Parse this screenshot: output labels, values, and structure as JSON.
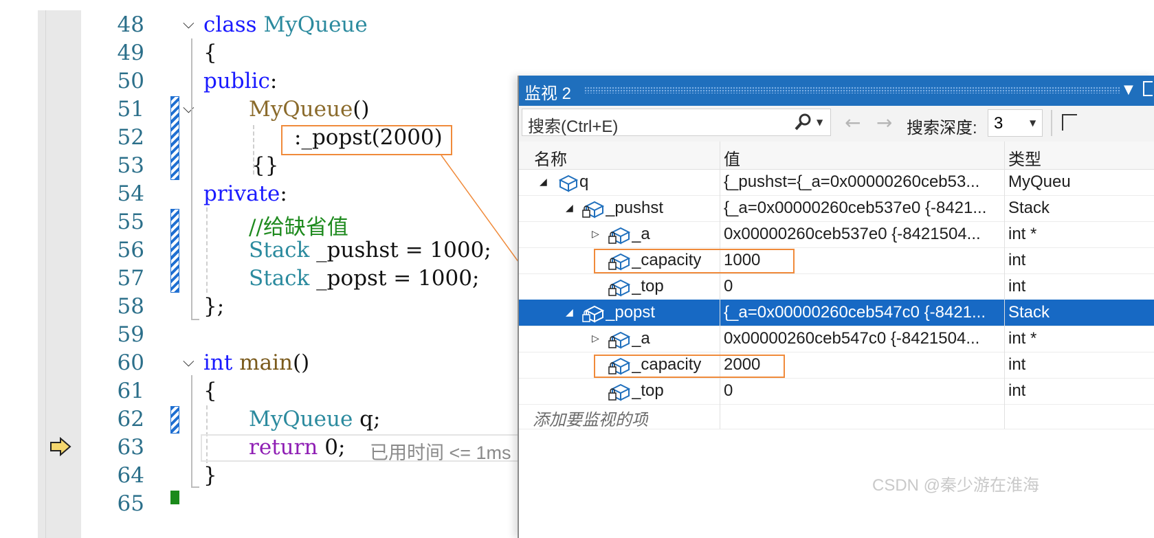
{
  "editor": {
    "lines": [
      {
        "num": "48",
        "parts": [
          [
            "kw",
            "class "
          ],
          [
            "cls",
            "MyQueue"
          ]
        ]
      },
      {
        "num": "49",
        "parts": [
          [
            "",
            "{"
          ]
        ]
      },
      {
        "num": "50",
        "parts": [
          [
            "kw",
            "public"
          ],
          [
            "",
            ":"
          ]
        ]
      },
      {
        "num": "51",
        "parts": [
          [
            "ctor",
            "MyQueue"
          ],
          [
            "",
            "()"
          ]
        ]
      },
      {
        "num": "52",
        "parts": [
          [
            "",
            ":_popst(2000)"
          ]
        ]
      },
      {
        "num": "53",
        "parts": [
          [
            "",
            "{}"
          ]
        ]
      },
      {
        "num": "54",
        "parts": [
          [
            "kw",
            "private"
          ],
          [
            "",
            ":"
          ]
        ]
      },
      {
        "num": "55",
        "parts": [
          [
            "cm",
            "//给缺省值"
          ]
        ]
      },
      {
        "num": "56",
        "parts": [
          [
            "ty",
            "Stack"
          ],
          [
            "",
            " _pushst = 1000;"
          ]
        ]
      },
      {
        "num": "57",
        "parts": [
          [
            "ty",
            "Stack"
          ],
          [
            "",
            " _popst = 1000;"
          ]
        ]
      },
      {
        "num": "58",
        "parts": [
          [
            "",
            "};"
          ]
        ]
      },
      {
        "num": "59",
        "parts": []
      },
      {
        "num": "60",
        "parts": [
          [
            "kw",
            "int "
          ],
          [
            "fn",
            "main"
          ],
          [
            "",
            "()"
          ]
        ]
      },
      {
        "num": "61",
        "parts": [
          [
            "",
            "{"
          ]
        ]
      },
      {
        "num": "62",
        "parts": [
          [
            "ty",
            "MyQueue"
          ],
          [
            "",
            " q;"
          ]
        ]
      },
      {
        "num": "63",
        "parts": [
          [
            "ret",
            "return"
          ],
          [
            "",
            " 0;"
          ]
        ]
      },
      {
        "num": "64",
        "parts": [
          [
            "",
            "}"
          ]
        ]
      },
      {
        "num": "65",
        "parts": []
      }
    ],
    "elapsed_hint": "已用时间 <= 1ms"
  },
  "watch": {
    "title": "监视 2",
    "search_placeholder": "搜索(Ctrl+E)",
    "search_depth_label": "搜索深度:",
    "search_depth_value": "3",
    "columns": {
      "name": "名称",
      "value": "值",
      "type": "类型"
    },
    "rows": [
      {
        "name": "q",
        "value": "{_pushst={_a=0x00000260ceb53...",
        "type": "MyQueu"
      },
      {
        "name": "_pushst",
        "value": "{_a=0x00000260ceb537e0 {-8421...",
        "type": "Stack"
      },
      {
        "name": "_a",
        "value": "0x00000260ceb537e0 {-8421504...",
        "type": "int *"
      },
      {
        "name": "_capacity",
        "value": "1000",
        "type": "int"
      },
      {
        "name": "_top",
        "value": "0",
        "type": "int"
      },
      {
        "name": "_popst",
        "value": "{_a=0x00000260ceb547c0 {-8421...",
        "type": "Stack"
      },
      {
        "name": "_a",
        "value": "0x00000260ceb547c0 {-8421504...",
        "type": "int *"
      },
      {
        "name": "_capacity",
        "value": "2000",
        "type": "int"
      },
      {
        "name": "_top",
        "value": "0",
        "type": "int"
      }
    ],
    "add_item_placeholder": "添加要监视的项"
  },
  "watermark": "CSDN @秦少游在淮海",
  "colors": {
    "accent": "#1f6fbd",
    "selection": "#1769c4",
    "highlight_box": "#f08a3a"
  }
}
